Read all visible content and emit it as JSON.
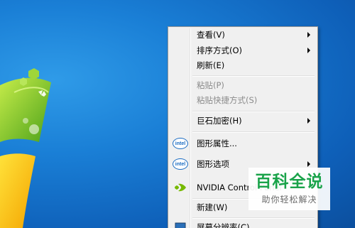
{
  "menu": {
    "view": "查看(V)",
    "sort": "排序方式(O)",
    "refresh": "刷新(E)",
    "paste": "粘贴(P)",
    "paste_shortcut": "粘贴快捷方式(S)",
    "encrypt": "巨石加密(H)",
    "graphics_properties": "图形属性...",
    "graphics_options": "图形选项",
    "nvidia": "NVIDIA Control Panel",
    "new": "新建(W)",
    "screen_resolution": "屏幕分辨率(C)"
  },
  "icons": {
    "intel_text": "intel",
    "intel_color": "#1a6bc2",
    "nvidia_color": "#76b900"
  },
  "watermark": {
    "title": "百科全说",
    "subtitle": "助你轻松解决",
    "color": "#1aa34a"
  }
}
